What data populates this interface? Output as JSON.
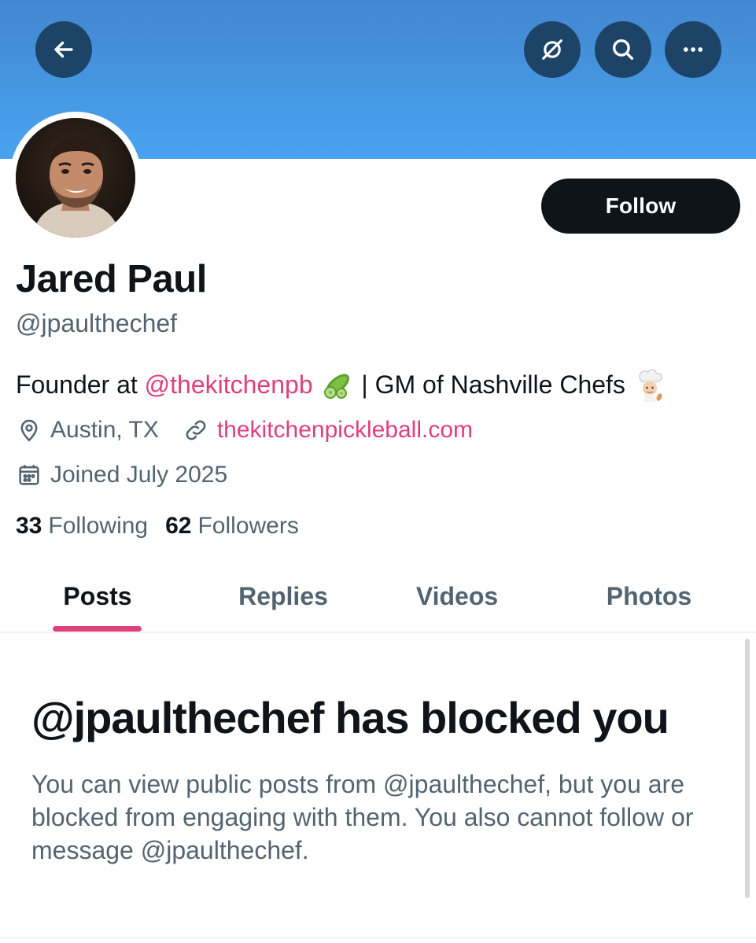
{
  "header": {
    "back_icon": "arrow-left-icon",
    "grok_icon": "grok-icon",
    "search_icon": "search-icon",
    "more_icon": "more-horizontal-icon",
    "banner_color": "#4597e2",
    "button_color": "#1d4467"
  },
  "profile": {
    "display_name": "Jared Paul",
    "handle": "@jpaulthechef",
    "follow_label": "Follow",
    "bio": {
      "prefix": "Founder at ",
      "mention": "@thekitchenpb",
      "emoji1": "cucumber-emoji",
      "middle": " | GM of Nashville Chefs ",
      "emoji2": "cook-emoji"
    },
    "location": "Austin, TX",
    "website": "thekitchenpickleball.com",
    "joined": "Joined July 2025",
    "following_count": "33",
    "following_label": "Following",
    "followers_count": "62",
    "followers_label": "Followers",
    "accent_color": "#e0407a"
  },
  "tabs": [
    {
      "label": "Posts",
      "active": true
    },
    {
      "label": "Replies",
      "active": false
    },
    {
      "label": "Videos",
      "active": false
    },
    {
      "label": "Photos",
      "active": false
    }
  ],
  "blocked": {
    "title": "@jpaulthechef has blocked you",
    "body": "You can view public posts from @jpaulthechef, but you are blocked from engaging with them. You also cannot follow or message @jpaulthechef."
  }
}
